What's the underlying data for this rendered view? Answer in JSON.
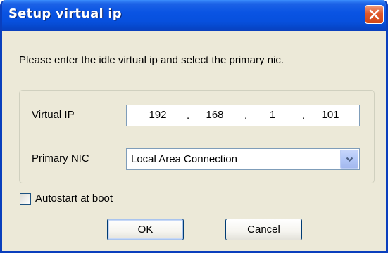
{
  "window": {
    "title": "Setup virtual ip",
    "close_icon": "close-icon"
  },
  "prompt": "Please enter the idle virtual ip and select the primary nic.",
  "virtual_ip": {
    "label": "Virtual IP",
    "octets": [
      "192",
      "168",
      "1",
      "101"
    ],
    "separator": "."
  },
  "primary_nic": {
    "label": "Primary NIC",
    "selected": "Local Area Connection",
    "dropdown_icon": "chevron-down-icon"
  },
  "autostart": {
    "label": "Autostart at boot",
    "checked": false
  },
  "buttons": {
    "ok": "OK",
    "cancel": "Cancel"
  },
  "colors": {
    "titlebar": "#0a54e3",
    "window_bg": "#ece9d8",
    "close_button": "#e0592c",
    "field_border": "#7f9db9"
  }
}
